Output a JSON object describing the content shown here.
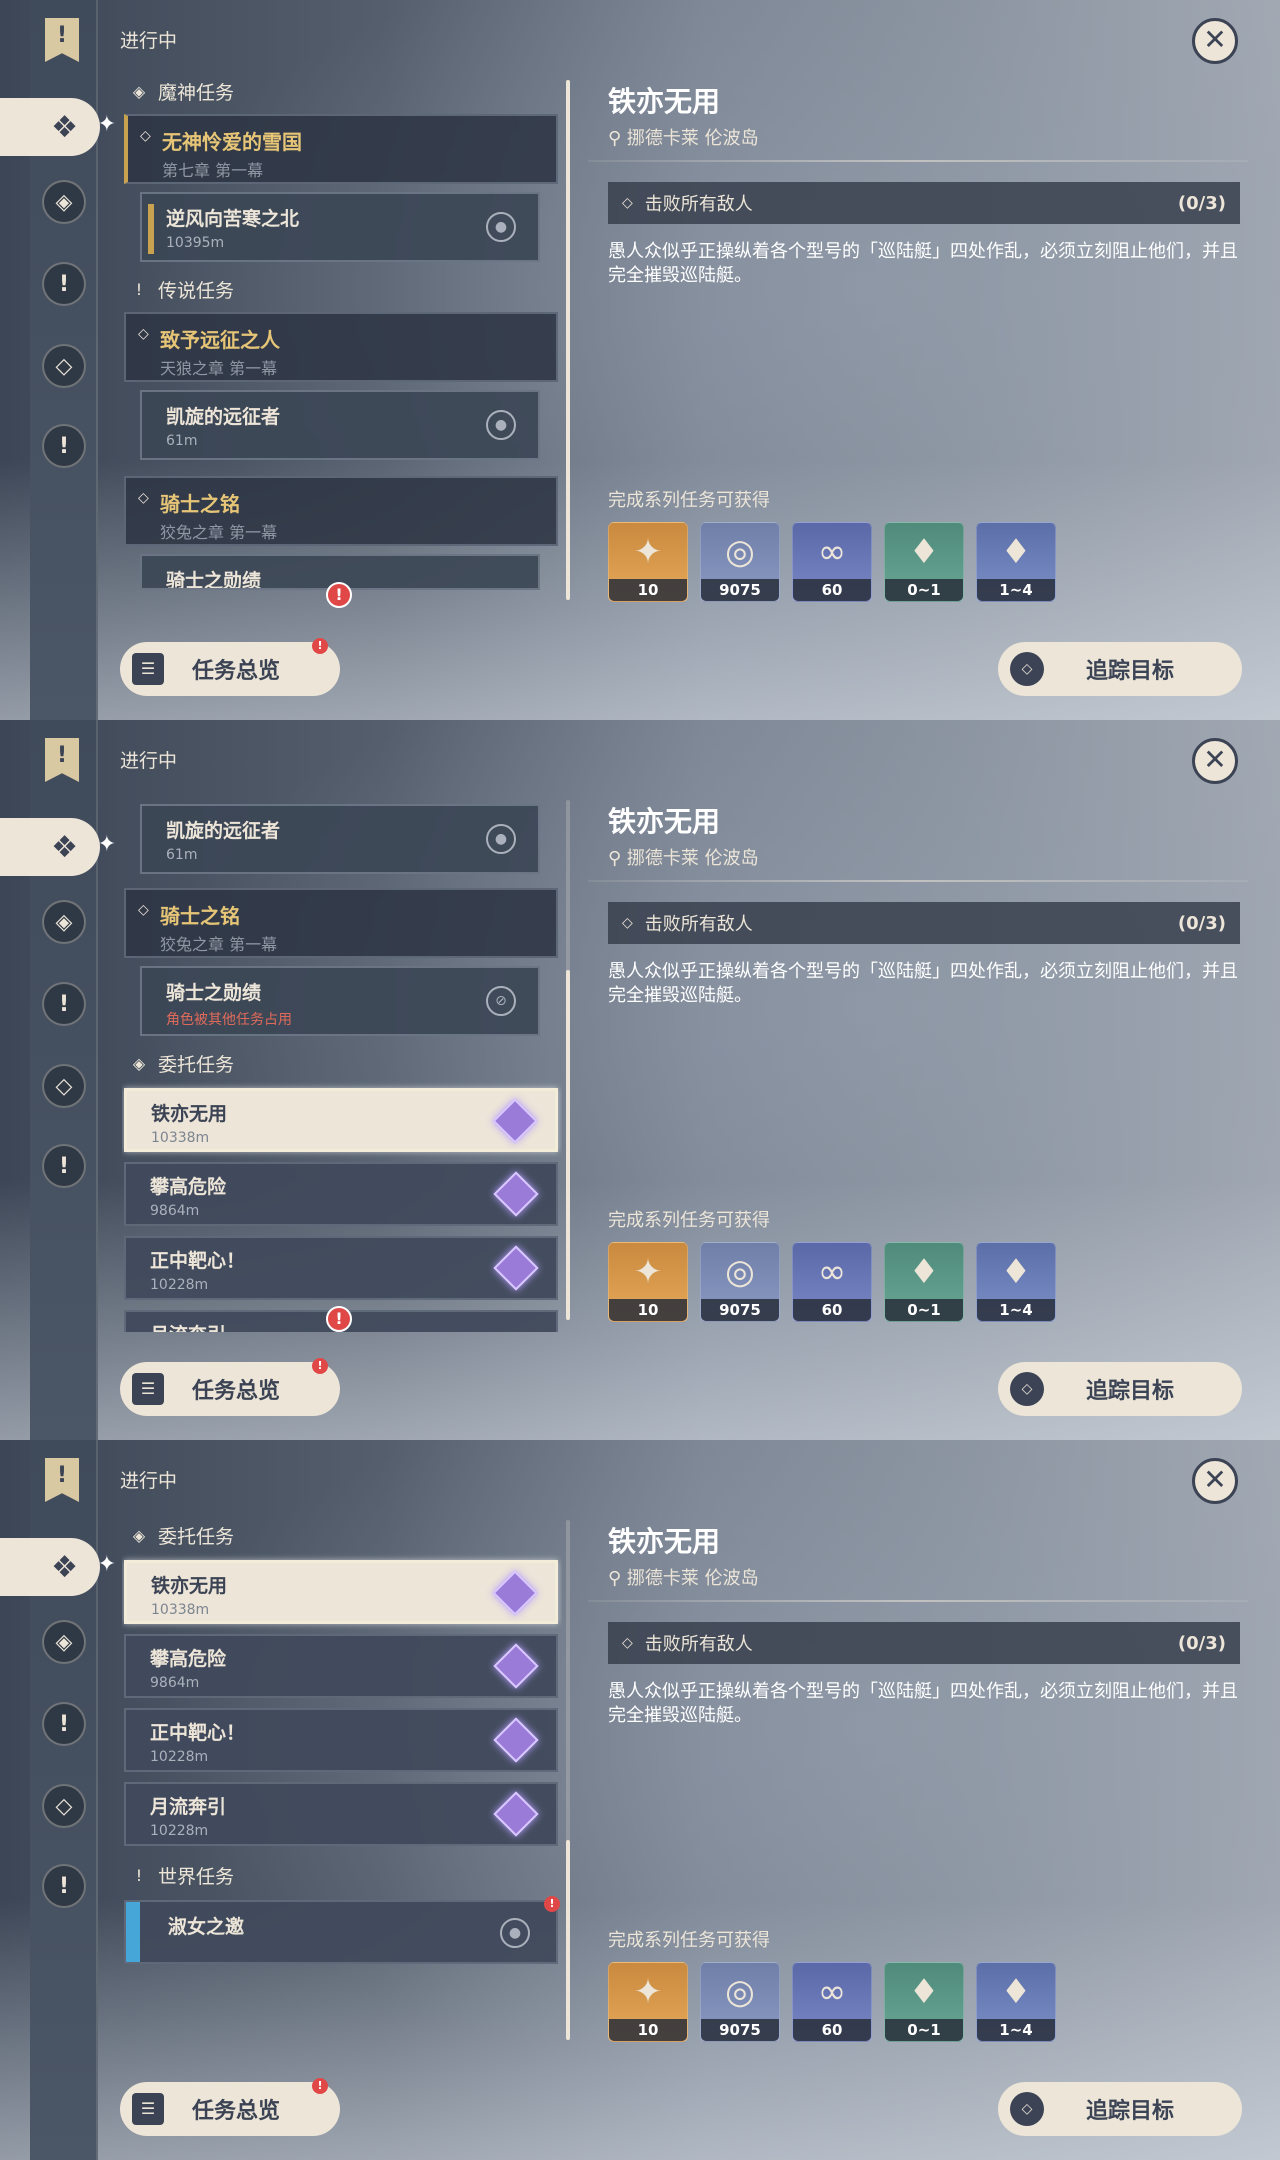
{
  "common": {
    "tab_label": "进行中",
    "close_glyph": "✕",
    "overview_label": "任务总览",
    "track_label": "追踪目标",
    "alert_glyph": "!",
    "detail": {
      "title": "铁亦无用",
      "location": "挪德卡莱 伦波岛",
      "objective": "击败所有敌人",
      "progress": "(0/3)",
      "description": "愚人众似乎正操纵着各个型号的「巡陆艇」四处作乱，必须立刻阻止他们，并且完全摧毁巡陆艇。",
      "rewards_title": "完成系列任务可获得",
      "rewards": [
        {
          "icon": "primogem-icon",
          "glyph": "✦",
          "count": "10"
        },
        {
          "icon": "mora-icon",
          "glyph": "◎",
          "count": "9075"
        },
        {
          "icon": "fate-icon",
          "glyph": "∞",
          "count": "60"
        },
        {
          "icon": "crystal-green-icon",
          "glyph": "♦",
          "count": "0~1"
        },
        {
          "icon": "crystal-purple-icon",
          "glyph": "♦",
          "count": "1~4"
        }
      ]
    }
  },
  "panel1": {
    "archon_section": "魔神任务",
    "archon_chapter": {
      "title": "无神怜爱的雪国",
      "sub": "第七章 第一幕"
    },
    "archon_quest": {
      "title": "逆风向苦寒之北",
      "dist": "10395m"
    },
    "legend_section": "传说任务",
    "legend_chapter1": {
      "title": "致予远征之人",
      "sub": "天狼之章 第一幕"
    },
    "legend_quest1": {
      "title": "凯旋的远征者",
      "dist": "61m"
    },
    "legend_chapter2": {
      "title": "骑士之铭",
      "sub": "狡兔之章 第一幕"
    },
    "legend_quest2": {
      "title": "骑士之勋绩"
    }
  },
  "panel2": {
    "legend_quest1": {
      "title": "凯旋的远征者",
      "dist": "61m"
    },
    "legend_chapter2": {
      "title": "骑士之铭",
      "sub": "狡兔之章 第一幕"
    },
    "legend_quest2": {
      "title": "骑士之勋绩",
      "note": "角色被其他任务占用"
    },
    "commission_section": "委托任务",
    "commissions": [
      {
        "title": "铁亦无用",
        "dist": "10338m"
      },
      {
        "title": "攀高危险",
        "dist": "9864m"
      },
      {
        "title": "正中靶心！",
        "dist": "10228m"
      },
      {
        "title": "月流奔引",
        "dist": ""
      }
    ]
  },
  "panel3": {
    "commission_section": "委托任务",
    "commissions": [
      {
        "title": "铁亦无用",
        "dist": "10338m"
      },
      {
        "title": "攀高危险",
        "dist": "9864m"
      },
      {
        "title": "正中靶心！",
        "dist": "10228m"
      },
      {
        "title": "月流奔引",
        "dist": "10228m"
      }
    ],
    "world_section": "世界任务",
    "world_quest": {
      "title": "淑女之邀"
    }
  }
}
